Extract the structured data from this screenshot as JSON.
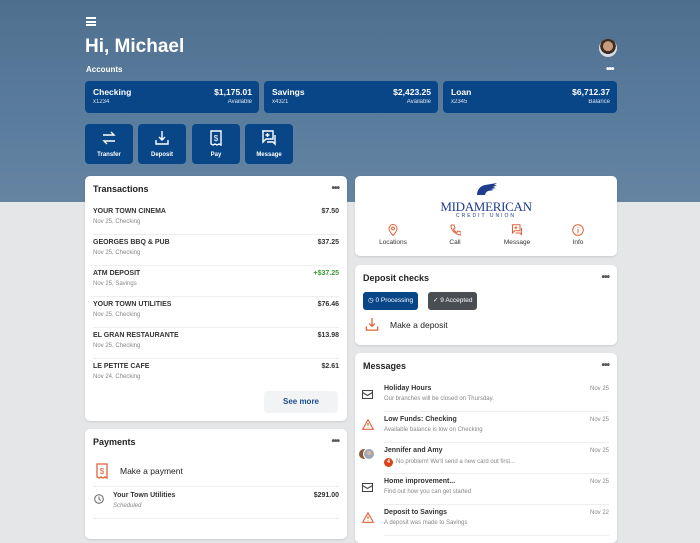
{
  "header": {
    "greeting": "Hi, Michael",
    "accounts_label": "Accounts",
    "more": "•••"
  },
  "accounts": [
    {
      "name": "Checking",
      "number": "x1234",
      "amount": "$1,175.01",
      "type": "Available"
    },
    {
      "name": "Savings",
      "number": "x4321",
      "amount": "$2,423.25",
      "type": "Available"
    },
    {
      "name": "Loan",
      "number": "x2345",
      "amount": "$6,712.37",
      "type": "Balance"
    }
  ],
  "actions": [
    {
      "label": "Transfer",
      "icon": "transfer-icon"
    },
    {
      "label": "Deposit",
      "icon": "deposit-icon"
    },
    {
      "label": "Pay",
      "icon": "bill-icon"
    },
    {
      "label": "Message",
      "icon": "message-icon"
    }
  ],
  "transactions": {
    "title": "Transactions",
    "more": "•••",
    "see_more": "See more",
    "items": [
      {
        "name": "YOUR TOWN CINEMA",
        "detail": "Nov 25, Checking",
        "amount": "$7.50"
      },
      {
        "name": "GEORGES BBQ & PUB",
        "detail": "Nov 25, Checking",
        "amount": "$37.25"
      },
      {
        "name": "ATM DEPOSIT",
        "detail": "Nov 25, Savings",
        "amount": "+$37.25"
      },
      {
        "name": "YOUR TOWN UTILITIES",
        "detail": "Nov 25, Checking",
        "amount": "$76.46"
      },
      {
        "name": "EL GRAN RESTAURANTE",
        "detail": "Nov 25, Checking",
        "amount": "$13.98"
      },
      {
        "name": "LE PETITE CAFE",
        "detail": "Nov 24, Checking",
        "amount": "$2.61"
      }
    ]
  },
  "payments": {
    "title": "Payments",
    "more": "•••",
    "make": "Make a payment",
    "items": [
      {
        "name": "Your Town Utilities",
        "status": "Scheduled",
        "amount": "$291.00"
      }
    ]
  },
  "branding": {
    "logo_main": "MIDAMERICAN",
    "logo_sub": "CREDIT UNION",
    "links": [
      "Locations",
      "Call",
      "Message",
      "Info"
    ]
  },
  "deposit": {
    "title": "Deposit checks",
    "more": "•••",
    "processing": "0 Processing",
    "accepted": "9 Accepted",
    "make": "Make a deposit"
  },
  "messages": {
    "title": "Messages",
    "more": "•••",
    "items": [
      {
        "title": "Holiday Hours",
        "body": "Our branches will be closed on Thursday.",
        "date": "Nov 25",
        "icon": "envelope-icon"
      },
      {
        "title": "Low Funds: Checking",
        "body": "Available balance is low on Checking",
        "date": "Nov 25",
        "icon": "warning-icon"
      },
      {
        "title": "Jennifer and Amy",
        "body": "No problem! We'll send a new card out first...",
        "date": "Nov 25",
        "icon": "avatar-group",
        "badge": "4"
      },
      {
        "title": "Home improvement...",
        "body": "Find out how you can get started",
        "date": "Nov 25",
        "icon": "envelope-icon"
      },
      {
        "title": "Deposit to Savings",
        "body": "A deposit was made to Savings",
        "date": "Nov 22",
        "icon": "warning-icon"
      }
    ]
  },
  "colors": {
    "primary": "#084687",
    "accent": "#e0623a",
    "positive": "#3c9a3c"
  }
}
